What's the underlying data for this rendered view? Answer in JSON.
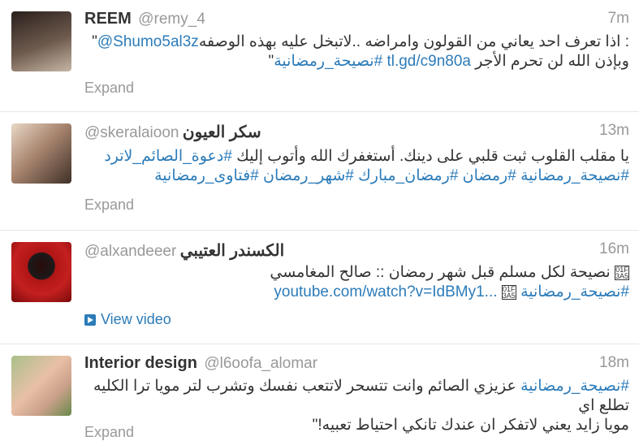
{
  "tweets": [
    {
      "name": "REEM",
      "handle": "@remy_4",
      "time": "7m",
      "line1_prefix": "\"",
      "line1_mention": "@Shumo5al3z",
      "line1_text": ": اذا تعرف احد يعاني من القولون وامراضه ..لاتبخل عليه بهذه الوصفه",
      "line2_text": "وبإذن الله لن تحرم الأجر",
      "line2_link": "tl.gd/c9n80a",
      "line2_hash": "#نصيحة_رمضانية",
      "line2_suffix": "\"",
      "action": "Expand",
      "avatar_colors": [
        "#3a2c28",
        "#b8a595"
      ]
    },
    {
      "name": "سكر العيون",
      "handle": "@skeralaioon",
      "time": "13m",
      "line1_text": "يا مقلب القلوب ثبت قلبي على دينك. أستغفرك الله وأتوب إليك",
      "line1_hash": "#دعوة_الصائم_لاترد",
      "line2_text": "#نصيحة_رمضانية #رمضان #رمضان_مبارك #شهر_رمضان #فتاوى_رمضانية",
      "action": "Expand",
      "avatar_colors": [
        "#d8c6b4",
        "#6b5444"
      ]
    },
    {
      "name": "الكسندر العتيبي",
      "handle": "@alxandeeer",
      "time": "16m",
      "line1_text": "نصيحة لكل مسلم قبل شهر رمضان :: صالح المغامسي",
      "line2_link": "youtube.com/watch?v=IdBMy1...",
      "line2_hash": "#نصيحة_رمضانية",
      "action": "View video",
      "avatar_colors": [
        "#b01010",
        "#1a1a1a"
      ]
    },
    {
      "name": "Interior design",
      "handle": "@l6oofa_alomar",
      "time": "18m",
      "line1_hash": "#نصيحة_رمضانية",
      "line1_text": "عزيزي الصائم وانت تتسحر لاتتعب نفسك وتشرب لتر مويا ترا الكليه تطلع اي",
      "line2_text": "مويا زايد يعني لاتفكر ان عندك تانكي احتياط تعبيه!\"",
      "action": "Expand",
      "avatar_colors": [
        "#8aa86a",
        "#d9a58a"
      ]
    }
  ]
}
